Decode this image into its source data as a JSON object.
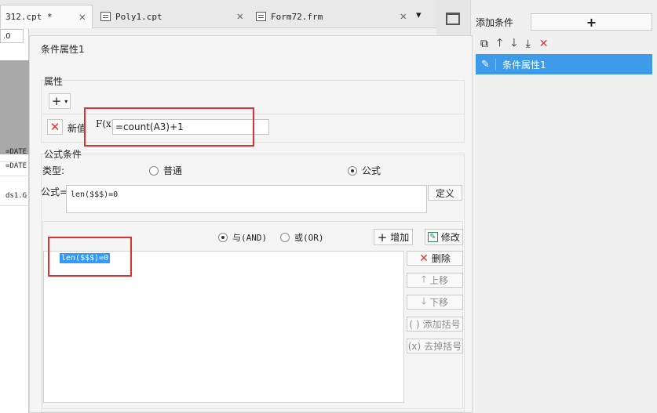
{
  "tabs": [
    {
      "label": "312.cpt *"
    },
    {
      "label": "Poly1.cpt"
    },
    {
      "label": "Form72.frm"
    }
  ],
  "sheet": {
    "cells": [
      "=DATE",
      "=DATE",
      "ds1.G"
    ],
    "dropdown_value": ".0"
  },
  "dialog": {
    "title": "条件属性1",
    "property_group": "属性",
    "new_value_label": "新值",
    "formula_icon": "F(x)",
    "new_value": "=count(A3)+1",
    "formula_condition_group": "公式条件",
    "type_label": "类型",
    "type_options": [
      "普通",
      "公式"
    ],
    "selected_type": "公式",
    "formula_label": "公式=",
    "formula_value": "len($$$)=0",
    "define_button": "定义",
    "logic_and": "与(AND)",
    "logic_or": "或(OR)",
    "selected_logic": "与(AND)",
    "add_button": "增加",
    "modify_button": "修改",
    "delete_button": "删除",
    "move_up_button": "上移",
    "move_down_button": "下移",
    "add_bracket_button": "添加括号",
    "remove_bracket_button": "去掉括号",
    "condition_items": [
      "len($$$)=0"
    ]
  },
  "right_panel": {
    "add_condition_label": "添加条件",
    "add_condition_button": "+",
    "items": [
      {
        "label": "条件属性1",
        "selected": true
      }
    ]
  },
  "colors": {
    "accent": "#3d9be9",
    "highlight_red": "#e03131",
    "selection_blue": "#3399ff"
  }
}
